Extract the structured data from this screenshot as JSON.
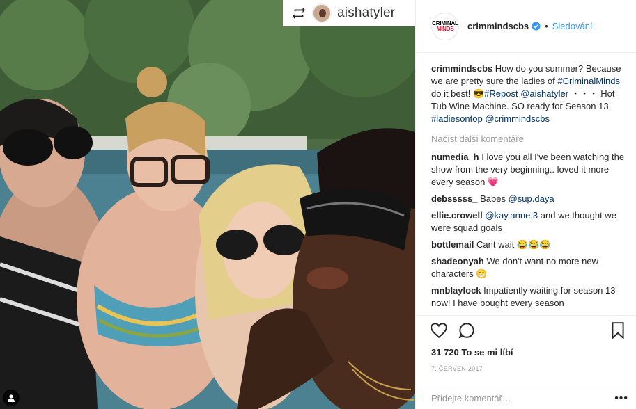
{
  "photo": {
    "repost_user": "aishatyler",
    "icons": {
      "repost": "repost-icon",
      "user_tag": "user-tag-icon"
    }
  },
  "header": {
    "avatar_line1": "CRIMINAL",
    "avatar_line2": "MINDS",
    "username": "crimmindscbs",
    "dot": "•",
    "follow": "Sledování",
    "colors": {
      "follow": "#3897f0",
      "verified": "#3897f0"
    }
  },
  "caption": {
    "user": "crimmindscbs",
    "text1": "How do you summer? Because we are pretty sure the ladies of ",
    "tag1": "#CriminalMinds",
    "text2": " do it best! 😎",
    "tag2": "#Repost",
    "mention1": "@aishatyler",
    "text3": " ・・・ Hot Tub Wine Machine. SO ready for Season 13. ",
    "tag3": "#ladiesontop",
    "mention2": "@crimmindscbs"
  },
  "load_more": "Načíst další komentáře",
  "comments": [
    {
      "user": "numedia_h",
      "text": "I love you all I've been watching the show from the very beginning.. loved it more every season 💗"
    },
    {
      "user": "debsssss_",
      "text": "Babes ",
      "mention": "@sup.daya"
    },
    {
      "user": "ellie.crowell",
      "mention": "@kay.anne.3",
      "text": " and we thought we were squad goals"
    },
    {
      "user": "bottlemail",
      "text": "Cant wait 😂😂😂"
    },
    {
      "user": "shadeonyah",
      "text": "We don't want no more new characters 😁"
    },
    {
      "user": "mnblaylock",
      "text": "Impatiently waiting for season 13 now! I have bought every season"
    }
  ],
  "likes": "31 720 To se mi líbí",
  "date": "7. ČERVEN 2017",
  "add_comment": {
    "placeholder": "Přidejte komentář…",
    "more": "•••"
  },
  "action_icons": [
    "heart-icon",
    "comment-icon",
    "bookmark-icon"
  ]
}
